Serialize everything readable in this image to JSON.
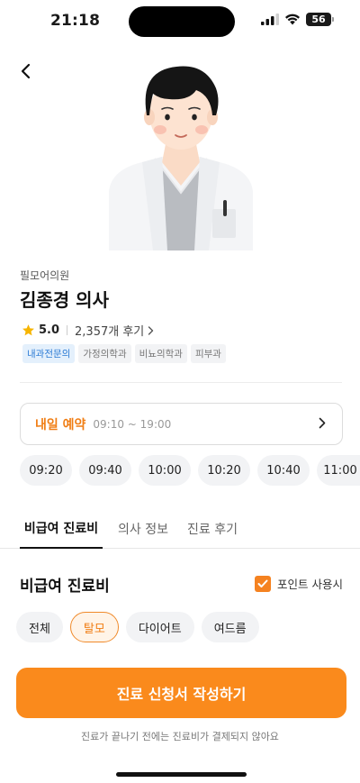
{
  "status_bar": {
    "time": "21:18",
    "battery": "56"
  },
  "clinic": {
    "name": "필모어의원"
  },
  "doctor": {
    "name": "김종경 의사"
  },
  "rating": {
    "score": "5.0",
    "reviews": "2,357개 후기"
  },
  "tags": [
    "내과전문의",
    "가정의학과",
    "비뇨의학과",
    "피부과"
  ],
  "reservation": {
    "label": "내일 예약",
    "hours": "09:10 ~ 19:00"
  },
  "time_slots": [
    "09:20",
    "09:40",
    "10:00",
    "10:20",
    "10:40",
    "11:00"
  ],
  "tabs": [
    "비급여 진료비",
    "의사 정보",
    "진료 후기"
  ],
  "fees": {
    "title": "비급여 진료비",
    "point_label": "포인트 사용시",
    "point_checked": true,
    "filters": [
      "전체",
      "탈모",
      "다이어트",
      "여드름"
    ],
    "selected_filter": "탈모"
  },
  "cta": {
    "label": "진료 신청서 작성하기",
    "note": "진료가 끝나기 전에는 진료비가 결제되지 않아요"
  },
  "colors": {
    "accent": "#fa8a1c",
    "accent_text": "#f07d13",
    "tag_blue": "#2a7ad4"
  },
  "icons": [
    "back-arrow-icon",
    "star-icon",
    "chevron-right-icon",
    "checkmark-icon",
    "signal-icon",
    "wifi-icon"
  ]
}
